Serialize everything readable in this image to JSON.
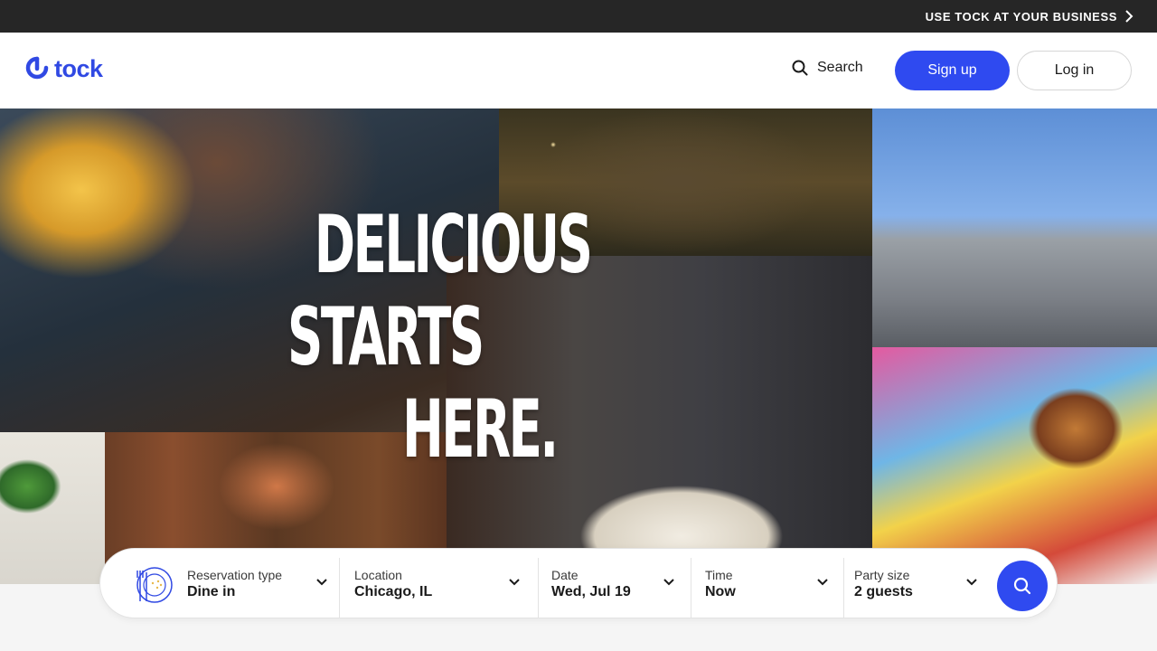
{
  "topbar": {
    "business_label": "USE TOCK AT YOUR BUSINESS"
  },
  "header": {
    "logo_text": "tock",
    "search_label": "Search",
    "signup_label": "Sign up",
    "login_label": "Log in"
  },
  "hero": {
    "headline": [
      "DELICIOUS",
      "STARTS",
      "HERE."
    ]
  },
  "search": {
    "reservation": {
      "label": "Reservation type",
      "value": "Dine in"
    },
    "location": {
      "label": "Location",
      "value": "Chicago, IL"
    },
    "date": {
      "label": "Date",
      "value": "Wed, Jul 19"
    },
    "time": {
      "label": "Time",
      "value": "Now"
    },
    "party": {
      "label": "Party size",
      "value": "2 guests"
    }
  },
  "colors": {
    "brand": "#2f4af0",
    "topbar": "#262626"
  },
  "icons": [
    "chevron-right-icon",
    "tock-logo-icon",
    "search-icon",
    "plate-cutlery-icon",
    "chevron-down-icon",
    "magnifier-icon"
  ]
}
